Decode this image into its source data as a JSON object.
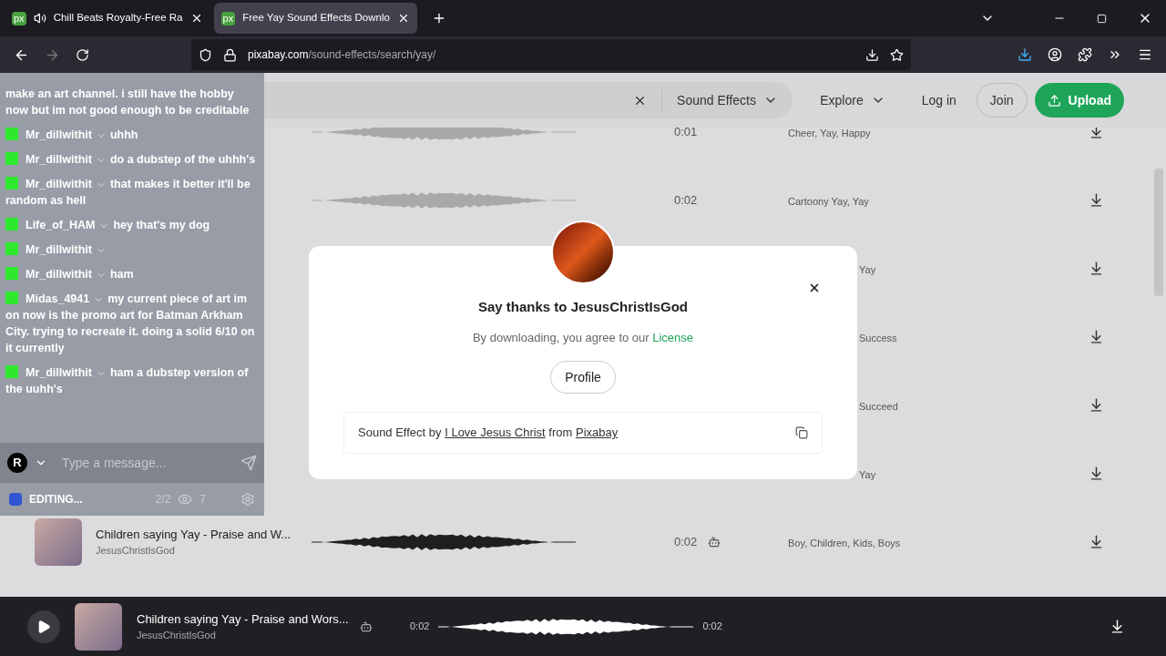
{
  "browser": {
    "tabs": [
      {
        "favicon": "px",
        "title": "Chill Beats Royalty-Free Ra",
        "audio": true,
        "selected": false
      },
      {
        "favicon": "px",
        "title": "Free Yay Sound Effects Downlo",
        "audio": false,
        "selected": true
      }
    ],
    "url": {
      "domain": "pixabay.com",
      "path": "/sound-effects/search/yay/"
    }
  },
  "header": {
    "search_filter": "Sound Effects",
    "nav": [
      "Explore"
    ],
    "login": "Log in",
    "join": "Join",
    "upload": "Upload"
  },
  "rows": [
    {
      "duration": "0:01",
      "tags": "Cheer, Yay, Happy",
      "waveform": true,
      "playing": false
    },
    {
      "duration": "0:02",
      "tags": "Cartoony Yay, Yay",
      "waveform": true,
      "playing": false
    },
    {
      "tags": "Yay"
    },
    {
      "tags": "Success"
    },
    {
      "tags": "Succeed"
    },
    {
      "tags": "Yay"
    },
    {
      "title": "Children saying Yay - Praise and W...",
      "author": "JesusChristIsGod",
      "duration": "0:02",
      "ai": true,
      "tags": "Boy, Children, Kids, Boys",
      "waveform": true,
      "playing": true
    }
  ],
  "modal": {
    "title": "Say thanks to JesusChristIsGod",
    "notice": "By downloading, you agree to our",
    "license_link": "License",
    "profile_button": "Profile",
    "attribution": {
      "prefix": "Sound Effect by",
      "author_link": "I Love Jesus Christ",
      "middle": "from",
      "site_link": "Pixabay"
    }
  },
  "player": {
    "title": "Children saying Yay - Praise and Wors...",
    "author": "JesusChristIsGod",
    "ai": true,
    "elapsed": "0:02",
    "total": "0:02",
    "playing": false
  },
  "chat": {
    "messages": [
      {
        "kind": "continuation",
        "text": "make an art channel. i still have the hobby now but im not good enough to be creditable"
      },
      {
        "kind": "message",
        "user": "Mr_dillwithit",
        "text": "uhhh"
      },
      {
        "kind": "message",
        "user": "Mr_dillwithit",
        "text": "do a dubstep of the uhhh's"
      },
      {
        "kind": "message",
        "user": "Mr_dillwithit",
        "text": "that makes it better it'll be random as hell"
      },
      {
        "kind": "message",
        "user": "Life_of_HAM",
        "text": "hey that's my dog"
      },
      {
        "kind": "message",
        "user": "Mr_dillwithit"
      },
      {
        "kind": "message",
        "user": "Mr_dillwithit",
        "text": "ham"
      },
      {
        "kind": "message",
        "user": "Midas_4941",
        "text": "my current piece of art im on now is the promo art for Batman Arkham City. trying to recreate it. doing a solid 6/10 on it currently"
      },
      {
        "kind": "message",
        "user": "Mr_dillwithit",
        "text": "ham a dubstep version of the uuhh's"
      }
    ],
    "avatar_letter": "R",
    "placeholder": "Type a message...",
    "status": "EDITING...",
    "count": "2/2",
    "viewers": "7"
  }
}
